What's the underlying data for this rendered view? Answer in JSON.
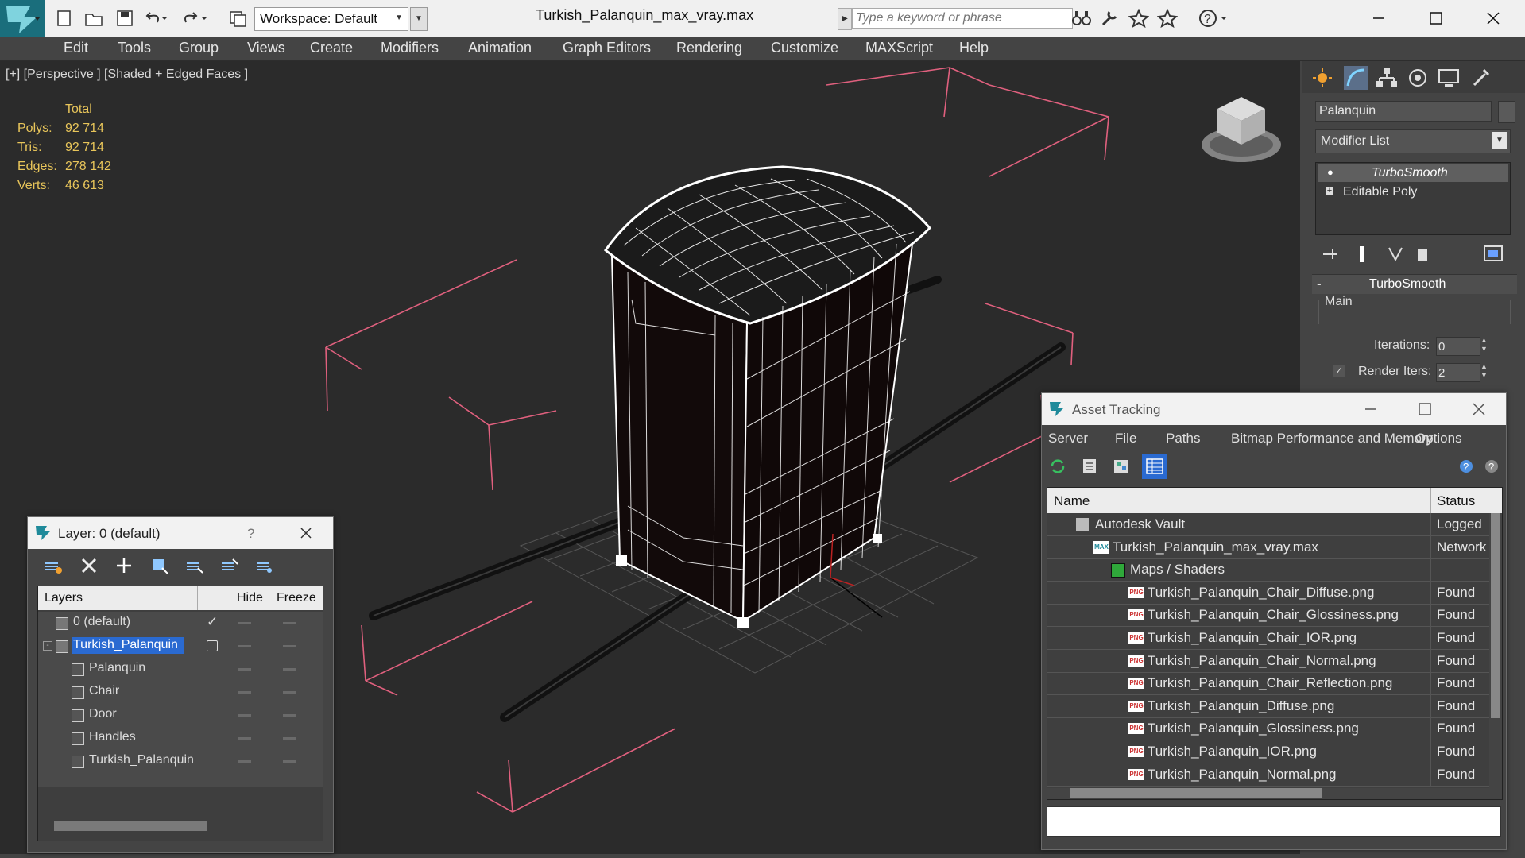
{
  "window": {
    "title": "Turkish_Palanquin_max_vray.max",
    "workspace": "Workspace: Default",
    "search_placeholder": "Type a keyword or phrase"
  },
  "menu": [
    "Edit",
    "Tools",
    "Group",
    "Views",
    "Create",
    "Modifiers",
    "Animation",
    "Graph Editors",
    "Rendering",
    "Customize",
    "MAXScript",
    "Help"
  ],
  "viewport": {
    "label": "[+] [Perspective ] [Shaded + Edged Faces ]",
    "stats_header": "Total",
    "stats": [
      {
        "label": "Polys:",
        "value": "92 714"
      },
      {
        "label": "Tris:",
        "value": "92 714"
      },
      {
        "label": "Edges:",
        "value": "278 142"
      },
      {
        "label": "Verts:",
        "value": "46 613"
      }
    ]
  },
  "command_panel": {
    "object_name": "Palanquin",
    "modifier_list": "Modifier List",
    "stack": [
      "TurboSmooth",
      "Editable Poly"
    ],
    "rollout_title": "TurboSmooth",
    "group_main": "Main",
    "iterations_label": "Iterations:",
    "iterations_value": "0",
    "render_iters_label": "Render Iters:",
    "render_iters_value": "2"
  },
  "layer_window": {
    "title": "Layer: 0 (default)",
    "help": "?",
    "columns": [
      "Layers",
      "Hide",
      "Freeze"
    ],
    "rows": [
      {
        "name": "0 (default)",
        "level": 0,
        "type": "layer"
      },
      {
        "name": "Turkish_Palanquin",
        "level": 0,
        "type": "layer",
        "selected": true
      },
      {
        "name": "Palanquin",
        "level": 1,
        "type": "object"
      },
      {
        "name": "Chair",
        "level": 1,
        "type": "object"
      },
      {
        "name": "Door",
        "level": 1,
        "type": "object"
      },
      {
        "name": "Handles",
        "level": 1,
        "type": "object"
      },
      {
        "name": "Turkish_Palanquin",
        "level": 1,
        "type": "object"
      }
    ]
  },
  "asset_window": {
    "title": "Asset Tracking",
    "menu": [
      "Server",
      "File",
      "Paths",
      "Bitmap Performance and Memory",
      "Options"
    ],
    "columns": [
      "Name",
      "Status"
    ],
    "rows": [
      {
        "name": "Autodesk Vault",
        "status": "Logged",
        "level": 0,
        "icon": "vault"
      },
      {
        "name": "Turkish_Palanquin_max_vray.max",
        "status": "Network",
        "level": 1,
        "icon": "max"
      },
      {
        "name": "Maps / Shaders",
        "status": "",
        "level": 2,
        "icon": "maps"
      },
      {
        "name": "Turkish_Palanquin_Chair_Diffuse.png",
        "status": "Found",
        "level": 3,
        "icon": "png"
      },
      {
        "name": "Turkish_Palanquin_Chair_Glossiness.png",
        "status": "Found",
        "level": 3,
        "icon": "png"
      },
      {
        "name": "Turkish_Palanquin_Chair_IOR.png",
        "status": "Found",
        "level": 3,
        "icon": "png"
      },
      {
        "name": "Turkish_Palanquin_Chair_Normal.png",
        "status": "Found",
        "level": 3,
        "icon": "png"
      },
      {
        "name": "Turkish_Palanquin_Chair_Reflection.png",
        "status": "Found",
        "level": 3,
        "icon": "png"
      },
      {
        "name": "Turkish_Palanquin_Diffuse.png",
        "status": "Found",
        "level": 3,
        "icon": "png"
      },
      {
        "name": "Turkish_Palanquin_Glossiness.png",
        "status": "Found",
        "level": 3,
        "icon": "png"
      },
      {
        "name": "Turkish_Palanquin_IOR.png",
        "status": "Found",
        "level": 3,
        "icon": "png"
      },
      {
        "name": "Turkish_Palanquin_Normal.png",
        "status": "Found",
        "level": 3,
        "icon": "png"
      }
    ],
    "icon_text": {
      "png": "PNG",
      "max": "MAX"
    }
  },
  "colors": {
    "accent_teal": "#1f8a9a",
    "selection_blue": "#2a6ad1",
    "bbox_pink": "#e0607e",
    "stats_yellow": "#e8c55a"
  }
}
